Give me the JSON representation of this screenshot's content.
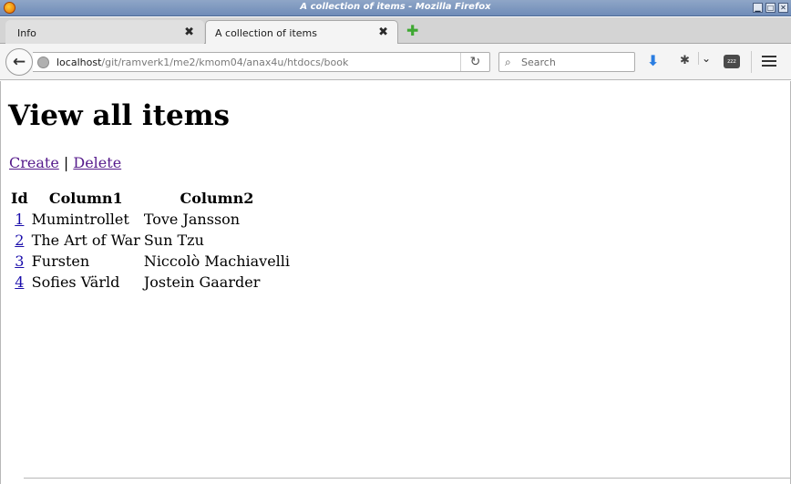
{
  "window": {
    "title": "A collection of items - Mozilla Firefox"
  },
  "tabs": [
    {
      "label": "Info",
      "active": false
    },
    {
      "label": "A collection of items",
      "active": true
    }
  ],
  "navbar": {
    "url_host": "localhost",
    "url_path": "/git/ramverk1/me2/kmom04/anax4u/htdocs/book",
    "search_placeholder": "Search",
    "sleep_label": "zzz"
  },
  "page": {
    "heading": "View all items",
    "actions": {
      "create": "Create",
      "separator": "|",
      "delete": "Delete"
    },
    "table": {
      "headers": [
        "Id",
        "Column1",
        "Column2"
      ],
      "rows": [
        {
          "id": "1",
          "column1": "Mumintrollet",
          "column2": "Tove Jansson"
        },
        {
          "id": "2",
          "column1": "The Art of War",
          "column2": "Sun Tzu"
        },
        {
          "id": "3",
          "column1": "Fursten",
          "column2": "Niccolò Machiavelli"
        },
        {
          "id": "4",
          "column1": "Sofies Värld",
          "column2": "Jostein Gaarder"
        }
      ]
    }
  },
  "colors": {
    "visited_link": "#551a8b",
    "unvisited_link": "#1a0dab",
    "titlebar": "#7c97c0",
    "download_accent": "#2a7de1",
    "newtab_accent": "#3ea832"
  }
}
